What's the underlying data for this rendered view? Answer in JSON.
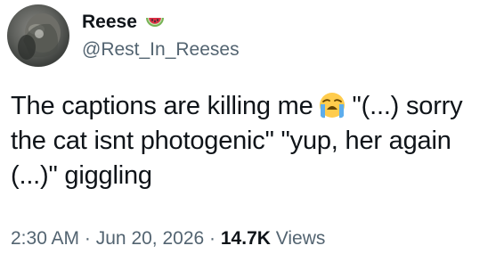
{
  "author": {
    "display_name": "Reese",
    "handle": "@Rest_In_Reeses",
    "name_emoji_icon": "watermelon-icon"
  },
  "tweet": {
    "line1_before_emoji": "The captions are killing me",
    "line1_emoji_icon": "loudly-crying-face-icon",
    "line1_after_emoji": "\"(...) sorry",
    "line2": "the cat isnt photogenic\" \"yup, her again",
    "line3": "(...)\" giggling"
  },
  "meta": {
    "time": "2:30 AM",
    "separator": "·",
    "date": "Jun 20, 2026",
    "views_count": "14.7K",
    "views_label": "Views"
  },
  "colors": {
    "text_primary": "#0f1419",
    "text_secondary": "#536471",
    "background": "#ffffff"
  }
}
